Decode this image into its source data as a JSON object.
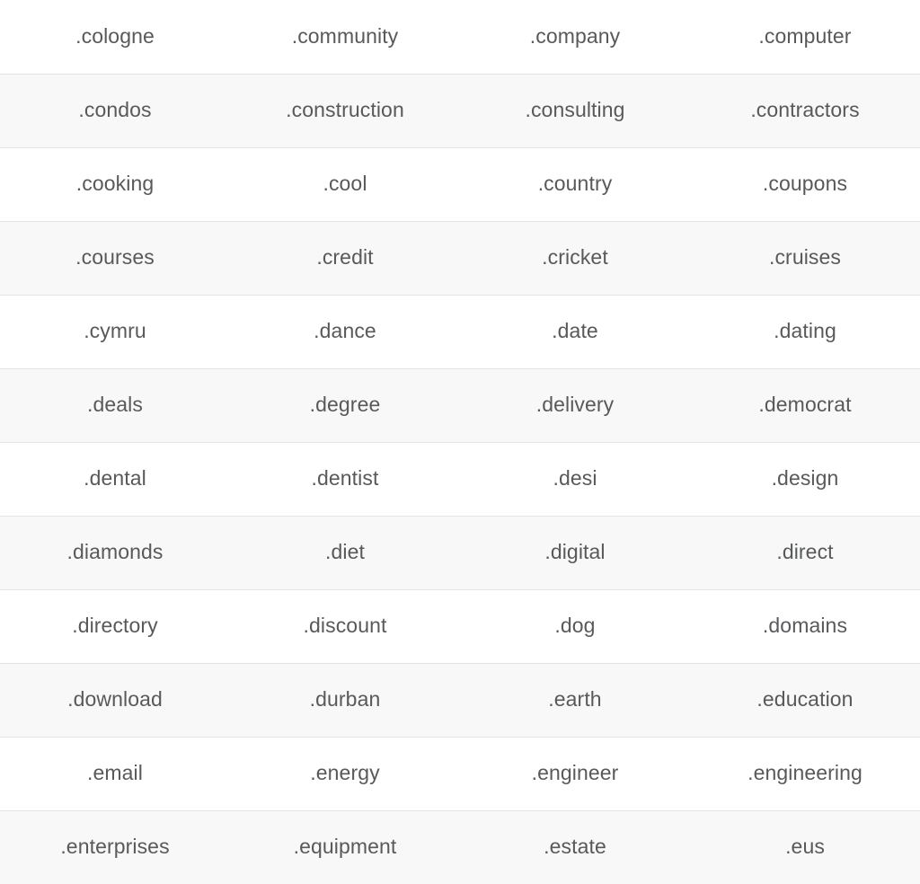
{
  "table": {
    "columns": 4,
    "row_count": 12,
    "colors": {
      "text": "#58595b",
      "row_odd_background": "#ffffff",
      "row_even_background": "#f8f8f8",
      "row_border": "#e4e4e4"
    },
    "rows": [
      {
        "stripe": "odd",
        "cells": [
          ".cologne",
          ".community",
          ".company",
          ".computer"
        ]
      },
      {
        "stripe": "even",
        "cells": [
          ".condos",
          ".construction",
          ".consulting",
          ".contractors"
        ]
      },
      {
        "stripe": "odd",
        "cells": [
          ".cooking",
          ".cool",
          ".country",
          ".coupons"
        ]
      },
      {
        "stripe": "even",
        "cells": [
          ".courses",
          ".credit",
          ".cricket",
          ".cruises"
        ]
      },
      {
        "stripe": "odd",
        "cells": [
          ".cymru",
          ".dance",
          ".date",
          ".dating"
        ]
      },
      {
        "stripe": "even",
        "cells": [
          ".deals",
          ".degree",
          ".delivery",
          ".democrat"
        ]
      },
      {
        "stripe": "odd",
        "cells": [
          ".dental",
          ".dentist",
          ".desi",
          ".design"
        ]
      },
      {
        "stripe": "even",
        "cells": [
          ".diamonds",
          ".diet",
          ".digital",
          ".direct"
        ]
      },
      {
        "stripe": "odd",
        "cells": [
          ".directory",
          ".discount",
          ".dog",
          ".domains"
        ]
      },
      {
        "stripe": "even",
        "cells": [
          ".download",
          ".durban",
          ".earth",
          ".education"
        ]
      },
      {
        "stripe": "odd",
        "cells": [
          ".email",
          ".energy",
          ".engineer",
          ".engineering"
        ]
      },
      {
        "stripe": "even",
        "cells": [
          ".enterprises",
          ".equipment",
          ".estate",
          ".eus"
        ]
      }
    ]
  }
}
